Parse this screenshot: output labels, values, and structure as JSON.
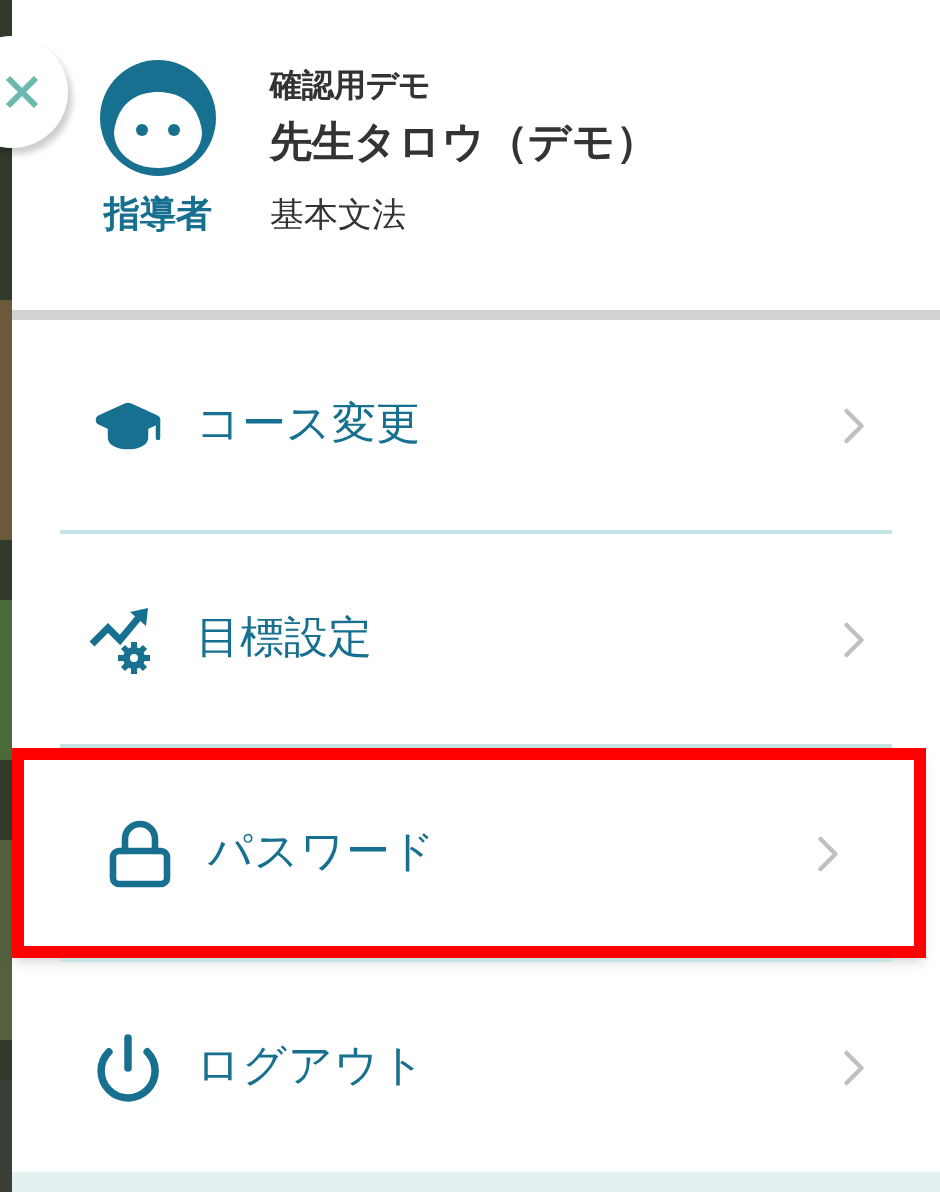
{
  "profile": {
    "role": "指導者",
    "school": "確認用デモ",
    "name": "先生タロウ（デモ）",
    "course": "基本文法"
  },
  "menu": [
    {
      "kind": "course",
      "label": "コース変更",
      "highlighted": false
    },
    {
      "kind": "goal",
      "label": "目標設定",
      "highlighted": false
    },
    {
      "kind": "password",
      "label": "パスワード",
      "highlighted": true
    },
    {
      "kind": "logout",
      "label": "ログアウト",
      "highlighted": false
    }
  ]
}
